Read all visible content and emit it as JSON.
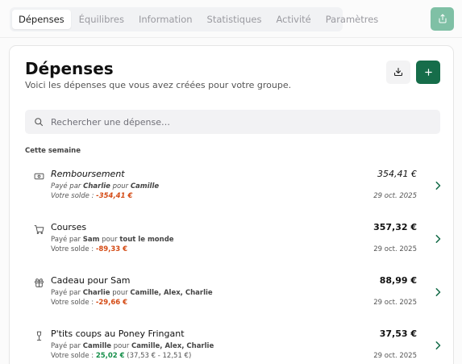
{
  "nav": {
    "tabs": [
      {
        "label": "Dépenses",
        "active": true
      },
      {
        "label": "Équilibres",
        "active": false
      },
      {
        "label": "Information",
        "active": false
      },
      {
        "label": "Statistiques",
        "active": false
      },
      {
        "label": "Activité",
        "active": false
      },
      {
        "label": "Paramètres",
        "active": false
      }
    ],
    "share_icon": "share-icon"
  },
  "header": {
    "title": "Dépenses",
    "subtitle": "Voici les dépenses que vous avez créées pour votre groupe.",
    "download_icon": "download-icon",
    "add_icon": "plus-icon"
  },
  "search": {
    "placeholder": "Rechercher une dépense…",
    "value": ""
  },
  "section": {
    "label": "Cette semaine"
  },
  "expenses": [
    {
      "icon": "banknote-icon",
      "title": "Remboursement",
      "paid_prefix": "Payé par",
      "payer": "Charlie",
      "for_word": "pour",
      "participants": "Camille",
      "balance_label": "Votre solde :",
      "balance": "-354,41 €",
      "balance_extra": "",
      "amount": "354,41 €",
      "date": "29 oct. 2025",
      "reimbursement": true
    },
    {
      "icon": "shopping-cart-icon",
      "title": "Courses",
      "paid_prefix": "Payé par",
      "payer": "Sam",
      "for_word": "pour",
      "participants": "tout le monde",
      "balance_label": "Votre solde :",
      "balance": "-89,33 €",
      "balance_extra": "",
      "amount": "357,32 €",
      "date": "29 oct. 2025",
      "reimbursement": false
    },
    {
      "icon": "gift-icon",
      "title": "Cadeau pour Sam",
      "paid_prefix": "Payé par",
      "payer": "Charlie",
      "for_word": "pour",
      "participants": "Camille, Alex, Charlie",
      "balance_label": "Votre solde :",
      "balance": "-29,66 €",
      "balance_extra": "",
      "amount": "88,99 €",
      "date": "29 oct. 2025",
      "reimbursement": false
    },
    {
      "icon": "wine-glass-icon",
      "title": "P'tits coups au Poney Fringant",
      "paid_prefix": "Payé par",
      "payer": "Camille",
      "for_word": "pour",
      "participants": "Camille, Alex, Charlie",
      "balance_label": "Votre solde :",
      "balance": "25,02 €",
      "balance_extra": "(37,53 € - 12,51 €)",
      "amount": "37,53 €",
      "date": "29 oct. 2025",
      "reimbursement": false
    }
  ],
  "colors": {
    "accent": "#166d4a",
    "share_button": "#7fc0a5",
    "negative": "#d44a14",
    "positive": "#168f4a"
  }
}
